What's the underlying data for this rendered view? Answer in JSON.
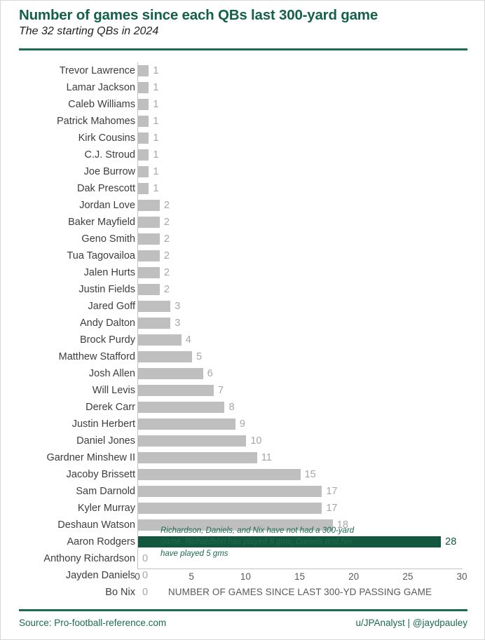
{
  "header": {
    "title": "Number of games since each QBs last 300-yard game",
    "subtitle": "The 32 starting QBs in 2024"
  },
  "annotation": "Richardson, Daniels, and Nix have not had a 300-yard game. Richardson has played 8 gms, Daniels and Nix have played 5 gms",
  "footer": {
    "source": "Source: Pro-football-reference.com",
    "credit": "u/JPAnalyst | @jaydpauley"
  },
  "colors": {
    "accent_green": "#14573F",
    "title_green": "#146049",
    "bar_gray": "#BFBFBF",
    "label_gray": "#A6A6A6"
  },
  "chart_data": {
    "type": "bar",
    "orientation": "horizontal",
    "title": "Number of games since each QBs last 300-yard game",
    "subtitle": "The 32 starting QBs in 2024",
    "xlabel": "NUMBER OF GAMES SINCE LAST 300-YD PASSING GAME",
    "ylabel": "",
    "xlim": [
      0,
      30
    ],
    "xticks": [
      0,
      5,
      10,
      15,
      20,
      25,
      30
    ],
    "grid": false,
    "legend": false,
    "highlight_category": "Aaron Rodgers",
    "categories": [
      "Trevor Lawrence",
      "Lamar Jackson",
      "Caleb Williams",
      "Patrick Mahomes",
      "Kirk Cousins",
      "C.J. Stroud",
      "Joe Burrow",
      "Dak Prescott",
      "Jordan Love",
      "Baker Mayfield",
      "Geno Smith",
      "Tua Tagovailoa",
      "Jalen Hurts",
      "Justin Fields",
      "Jared Goff",
      "Andy Dalton",
      "Brock Purdy",
      "Matthew Stafford",
      "Josh Allen",
      "Will Levis",
      "Derek Carr",
      "Justin Herbert",
      "Daniel Jones",
      "Gardner Minshew II",
      "Jacoby Brissett",
      "Sam Darnold",
      "Kyler Murray",
      "Deshaun Watson",
      "Aaron Rodgers",
      "Anthony Richardson",
      "Jayden Daniels",
      "Bo Nix"
    ],
    "values": [
      1,
      1,
      1,
      1,
      1,
      1,
      1,
      1,
      2,
      2,
      2,
      2,
      2,
      2,
      3,
      3,
      4,
      5,
      6,
      7,
      8,
      9,
      10,
      11,
      15,
      17,
      17,
      18,
      28,
      0,
      0,
      0
    ],
    "value_labels": [
      "1",
      "1",
      "1",
      "1",
      "1",
      "1",
      "1",
      "1",
      "2",
      "2",
      "2",
      "2",
      "2",
      "2",
      "3",
      "3",
      "4",
      "5",
      "6",
      "7",
      "8",
      "9",
      "10",
      "11",
      "15",
      "17",
      "17",
      "18",
      "28",
      "0",
      "0",
      "0"
    ]
  }
}
